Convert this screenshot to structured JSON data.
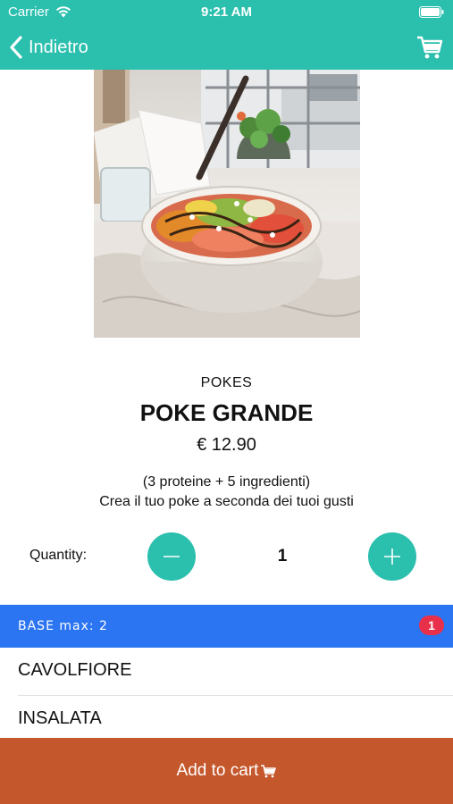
{
  "status_bar": {
    "carrier": "Carrier",
    "time": "9:21 AM"
  },
  "nav": {
    "back_label": "Indietro"
  },
  "product": {
    "category": "POKES",
    "name": "POKE GRANDE",
    "price": "€ 12.90",
    "description_line1": "(3 proteine + 5 ingredienti)",
    "description_line2": "Crea il tuo poke a seconda dei tuoi gusti"
  },
  "quantity": {
    "label": "Quantity:",
    "value": "1"
  },
  "section": {
    "label": "BASE max: 2",
    "badge": "1"
  },
  "options": [
    {
      "label": "CAVOLFIORE"
    },
    {
      "label": "INSALATA"
    }
  ],
  "cta": {
    "label": "Add to cart"
  },
  "colors": {
    "teal": "#2bbfae",
    "section_blue": "#2b74f2",
    "badge_red": "#e8304a",
    "cta_orange": "#c4572b"
  },
  "icons": [
    "wifi-icon",
    "battery-icon",
    "chevron-left-icon",
    "cart-icon",
    "minus-icon",
    "plus-icon"
  ]
}
